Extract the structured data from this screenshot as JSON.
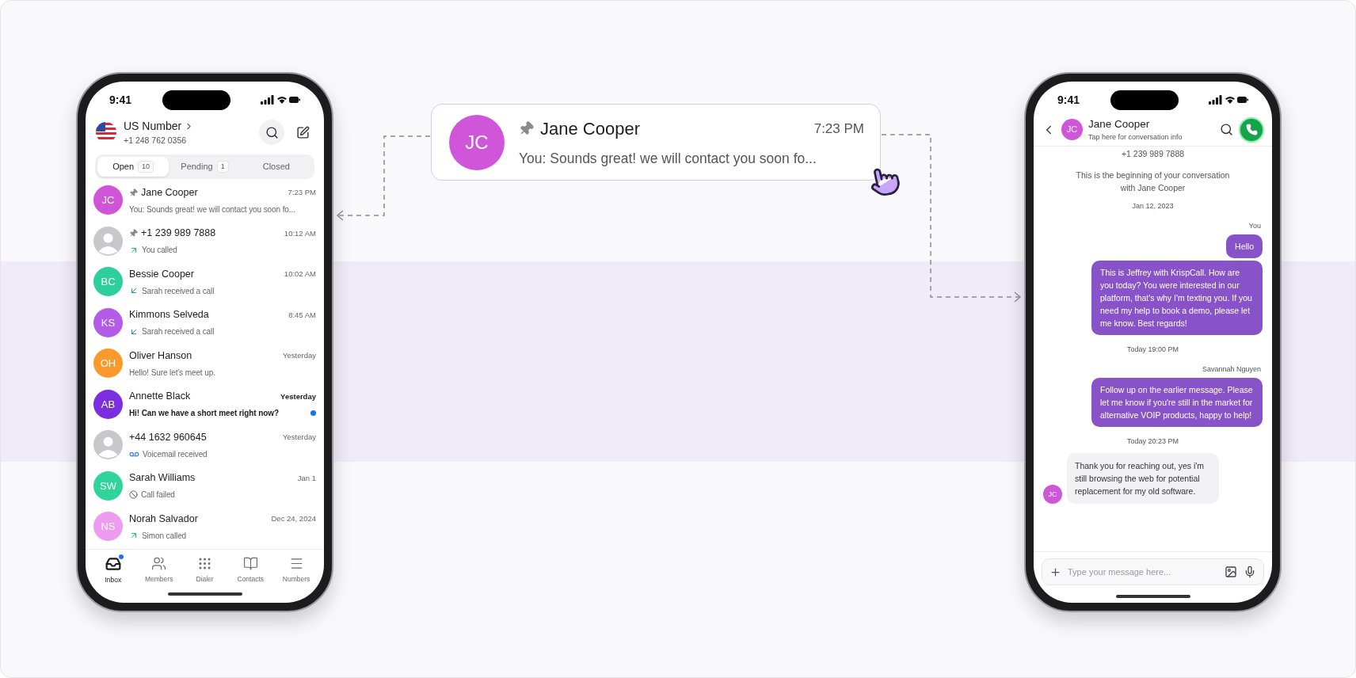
{
  "inbox_phone": {
    "status_bar": {
      "time": "9:41"
    },
    "header": {
      "title": "US Number",
      "subtitle": "+1 248 762 0356"
    },
    "tabs": [
      {
        "label": "Open",
        "count": "10",
        "selected": true
      },
      {
        "label": "Pending",
        "count": "1",
        "selected": false
      },
      {
        "label": "Closed",
        "selected": false
      }
    ],
    "conversations": [
      {
        "avatar": {
          "kind": "initials",
          "initials": "JC",
          "color": "#d054d8"
        },
        "name": "Jane Cooper",
        "pinned": true,
        "time": "7:23 PM",
        "preview": {
          "kind": "message",
          "text": "You: Sounds great! we will contact you soon fo..."
        },
        "unread": false
      },
      {
        "avatar": {
          "kind": "unknown"
        },
        "name": "+1 239 989 7888",
        "pinned": true,
        "time": "10:12 AM",
        "preview": {
          "kind": "outgoing_call",
          "text": "You called"
        },
        "unread": false
      },
      {
        "avatar": {
          "kind": "initials",
          "initials": "BC",
          "color": "#2fcf9c"
        },
        "name": "Bessie Cooper",
        "pinned": false,
        "time": "10:02 AM",
        "preview": {
          "kind": "incoming_call",
          "text": "Sarah received a call"
        },
        "unread": false
      },
      {
        "avatar": {
          "kind": "initials",
          "initials": "KS",
          "color": "#b45ce8"
        },
        "name": "Kimmons Selveda",
        "pinned": false,
        "time": "8:45 AM",
        "preview": {
          "kind": "incoming_call",
          "text": "Sarah received a call"
        },
        "unread": false
      },
      {
        "avatar": {
          "kind": "initials",
          "initials": "OH",
          "color": "#fb9a2c"
        },
        "name": "Oliver Hanson",
        "pinned": false,
        "time": "Yesterday",
        "preview": {
          "kind": "message",
          "text": "Hello! Sure let's meet up."
        },
        "unread": false
      },
      {
        "avatar": {
          "kind": "initials",
          "initials": "AB",
          "color": "#7a2ee0"
        },
        "name": "Annette Black",
        "pinned": false,
        "time": "Yesterday",
        "preview": {
          "kind": "message",
          "text": "Hi! Can we have a short meet right now?"
        },
        "unread": true
      },
      {
        "avatar": {
          "kind": "unknown"
        },
        "name": "+44 1632 960645",
        "pinned": false,
        "time": "Yesterday",
        "preview": {
          "kind": "voicemail",
          "text": "Voicemail received"
        },
        "unread": false
      },
      {
        "avatar": {
          "kind": "initials",
          "initials": "SW",
          "color": "#30d49a"
        },
        "name": "Sarah Williams",
        "pinned": false,
        "time": "Jan 1",
        "preview": {
          "kind": "failed",
          "text": "Call failed"
        },
        "unread": false
      },
      {
        "avatar": {
          "kind": "initials",
          "initials": "NS",
          "color": "#ee9cf0"
        },
        "name": "Norah Salvador",
        "pinned": false,
        "time": "Dec 24, 2024",
        "preview": {
          "kind": "outgoing_call",
          "text": "Simon called"
        },
        "unread": false
      }
    ],
    "bottom_nav": [
      {
        "kind": "inbox",
        "label": "Inbox",
        "selected": true,
        "badge": true
      },
      {
        "kind": "members",
        "label": "Members",
        "selected": false,
        "badge": false
      },
      {
        "kind": "dialer",
        "label": "Dialer",
        "selected": false,
        "badge": false
      },
      {
        "kind": "contacts",
        "label": "Contacts",
        "selected": false,
        "badge": false
      },
      {
        "kind": "numbers",
        "label": "Numbers",
        "selected": false,
        "badge": false
      }
    ]
  },
  "highlight_card": {
    "avatar": {
      "initials": "JC",
      "color": "#cf55d9"
    },
    "name": "Jane Cooper",
    "pinned": true,
    "time": "7:23 PM",
    "preview": "You: Sounds great! we will contact you soon fo..."
  },
  "chat_phone": {
    "status_bar": {
      "time": "9:41"
    },
    "header": {
      "avatar": {
        "initials": "JC",
        "color": "#cf55d9"
      },
      "name": "Jane Cooper",
      "subtitle": "Tap here for conversation info"
    },
    "messages": [
      {
        "kind": "phone",
        "text": "+1 239 989 7888"
      },
      {
        "kind": "notice",
        "text": "This is the beginning of your conversation with Jane Cooper"
      },
      {
        "kind": "date",
        "text": "Jan 12, 2023"
      },
      {
        "kind": "sender",
        "text": "You"
      },
      {
        "kind": "outgoing",
        "text": "Hello"
      },
      {
        "kind": "outgoing",
        "text": "This is Jeffrey with KrispCall. How are you today? You were interested in our platform, that's why I'm texting you. If you need my help to book a demo, please let me know. Best regards!"
      },
      {
        "kind": "date",
        "text": "Today 19:00 PM"
      },
      {
        "kind": "sender",
        "text": "Savannah Nguyen"
      },
      {
        "kind": "outgoing",
        "text": "Follow up on the earlier message. Please let me know if you're still in the market for alternative VOIP products, happy to help!"
      },
      {
        "kind": "date",
        "text": "Today 20:23 PM"
      },
      {
        "kind": "incoming",
        "text": "Thank you for reaching out, yes i'm still browsing the web for potential replacement for my old software.",
        "avatar": {
          "initials": "JC",
          "color": "#cf55d9"
        }
      }
    ],
    "composer": {
      "placeholder": "Type your message here..."
    }
  }
}
